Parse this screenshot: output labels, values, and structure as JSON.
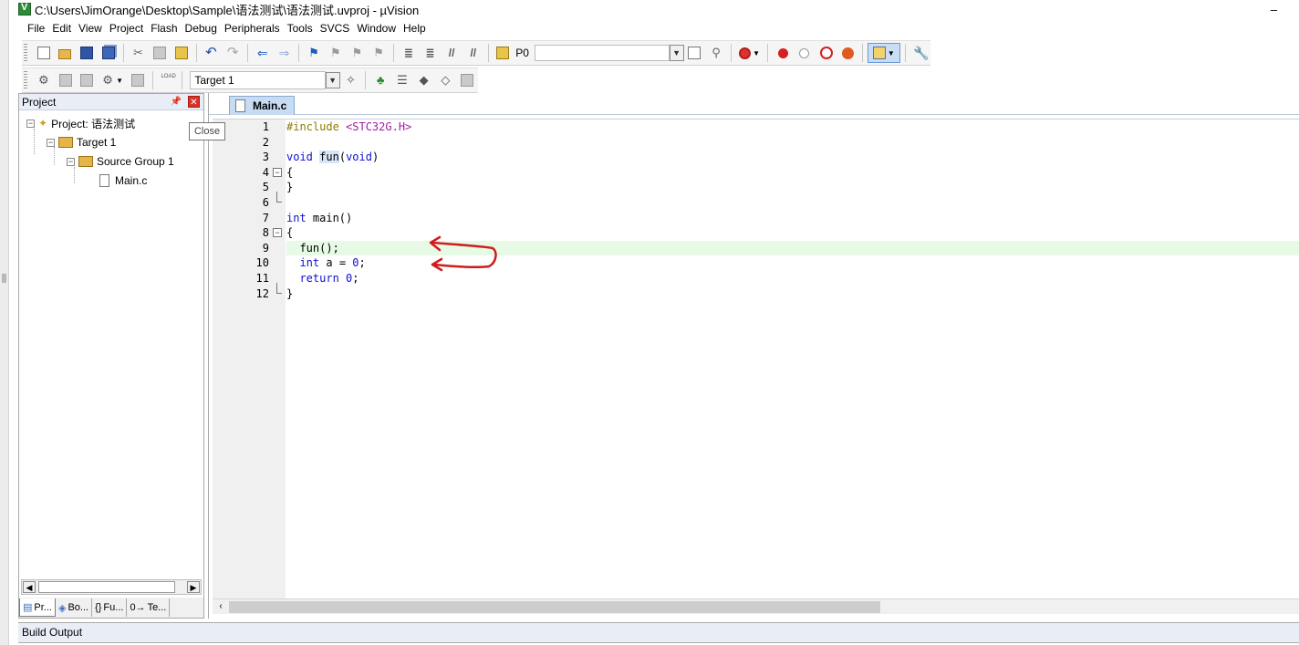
{
  "window": {
    "title": "C:\\Users\\JimOrange\\Desktop\\Sample\\语法测试\\语法测试.uvproj - µVision",
    "minimize_glyph": "–"
  },
  "menu": [
    "File",
    "Edit",
    "View",
    "Project",
    "Flash",
    "Debug",
    "Peripherals",
    "Tools",
    "SVCS",
    "Window",
    "Help"
  ],
  "toolbar": {
    "find_label": "P0",
    "target": "Target 1",
    "load_label": "LOAD"
  },
  "project_panel": {
    "title": "Project",
    "tooltip": "Close",
    "tree": {
      "project": "Project: 语法测试",
      "target": "Target 1",
      "group": "Source Group 1",
      "file": "Main.c"
    },
    "tabs": [
      "Pr...",
      "Bo...",
      "Fu...",
      "Te..."
    ]
  },
  "editor": {
    "tab": "Main.c",
    "lines": [
      {
        "n": "1"
      },
      {
        "n": "2"
      },
      {
        "n": "3"
      },
      {
        "n": "4"
      },
      {
        "n": "5"
      },
      {
        "n": "6"
      },
      {
        "n": "7"
      },
      {
        "n": "8"
      },
      {
        "n": "9"
      },
      {
        "n": "10"
      },
      {
        "n": "11"
      },
      {
        "n": "12"
      }
    ],
    "code": {
      "l1_pp": "#include",
      "l1_hdr": "<STC32G.H>",
      "l3_kw1": "void",
      "l3_fn": "fun",
      "l3_paren_open": "(",
      "l3_kw2": "void",
      "l3_paren_close": ")",
      "brace_open": "{",
      "brace_close": "}",
      "l7_kw": "int",
      "l7_rest": " main()",
      "l9": "  fun();",
      "l10_kw": "int",
      "l10_rest": " a = ",
      "l10_num": "0",
      "l10_end": ";",
      "l11_kw": "return",
      "l11_num": "0",
      "l11_end": ";"
    },
    "current_line": 9
  },
  "build_output": {
    "title": "Build Output"
  },
  "colors": {
    "annotation_red": "#d01c1c",
    "current_line_bg": "#e6fae6",
    "tab_active_bg": "#c7dbf3"
  }
}
